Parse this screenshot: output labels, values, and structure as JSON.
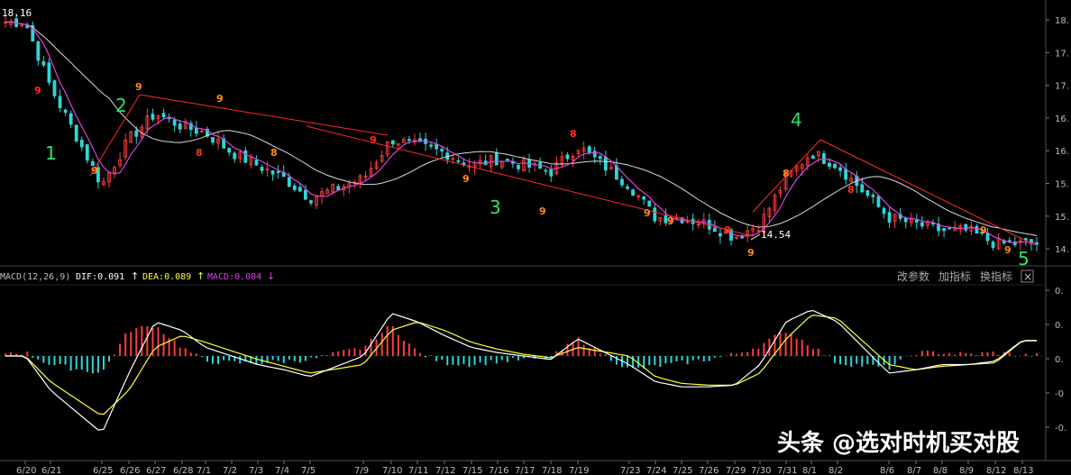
{
  "price_panel": {
    "top_left_label": "18.16",
    "low_label": "14.54",
    "wave_labels": [
      "1",
      "2",
      "3",
      "4",
      "5"
    ],
    "yticks": [
      "18.",
      "17.",
      "17.",
      "16.",
      "16.",
      "15.",
      "15.",
      "14."
    ],
    "td_labels": [
      "9",
      "9",
      "9",
      "8",
      "9",
      "8",
      "9",
      "9",
      "9",
      "8",
      "9",
      "9",
      "8",
      "9",
      "8",
      "8",
      "9",
      "9"
    ]
  },
  "macd_header": {
    "params": "MACD(12,26,9)",
    "dif_label": "DIF:0.091",
    "dif_arrow": "↑",
    "dea_label": "DEA:0.089",
    "dea_arrow": "↑",
    "macd_label": "MACD:0.004",
    "macd_arrow": "↓",
    "btn_params": "改参数",
    "btn_add": "加指标",
    "btn_switch": "换指标",
    "btn_close": "×"
  },
  "macd_panel": {
    "yticks": [
      "0.",
      "0.",
      "0.",
      "-0",
      "-0."
    ]
  },
  "x_axis": {
    "dates": [
      "6/20",
      "6/21",
      "6/25",
      "6/26",
      "6/27",
      "6/28",
      "7/1",
      "7/2",
      "7/3",
      "7/4",
      "7/5",
      "7/9",
      "7/10",
      "7/11",
      "7/12",
      "7/15",
      "7/16",
      "7/17",
      "7/18",
      "7/19",
      "7/23",
      "7/24",
      "7/25",
      "7/26",
      "7/29",
      "7/30",
      "7/31",
      "8/1",
      "8/2",
      "8/6",
      "8/7",
      "8/8",
      "8/9",
      "8/12",
      "8/13"
    ]
  },
  "watermark": {
    "text": "头条 @选对时机买对股"
  },
  "colors": {
    "up": "#ff3c3c",
    "down": "#2fd6d6",
    "ma_short": "#e040e0",
    "ma_long": "#d8d8d8",
    "dea": "#ffff33",
    "dif": "#ffffff",
    "wave": "#2ee36a",
    "td_orange": "#ff8c1a",
    "td_red": "#ff3020",
    "trend": "#ff2a2a"
  },
  "chart_data": [
    {
      "type": "candlestick",
      "title": "",
      "x": [
        "6/20",
        "6/21",
        "6/25",
        "6/26",
        "6/27",
        "6/28",
        "7/1",
        "7/2",
        "7/3",
        "7/4",
        "7/5",
        "7/9",
        "7/10",
        "7/11",
        "7/12",
        "7/15",
        "7/16",
        "7/17",
        "7/18",
        "7/19",
        "7/23",
        "7/24",
        "7/25",
        "7/26",
        "7/29",
        "7/30",
        "7/31",
        "8/1",
        "8/2",
        "8/6",
        "8/7",
        "8/8",
        "8/9",
        "8/12",
        "8/13"
      ],
      "close_approx": [
        18.0,
        17.0,
        15.5,
        16.2,
        16.6,
        16.4,
        16.3,
        16.0,
        15.8,
        15.6,
        15.3,
        15.6,
        16.2,
        16.1,
        16.0,
        15.8,
        15.9,
        15.8,
        15.7,
        16.1,
        15.5,
        15.0,
        15.0,
        14.9,
        14.7,
        14.9,
        15.6,
        16.0,
        15.8,
        15.0,
        14.9,
        14.8,
        14.8,
        14.6,
        14.6
      ],
      "ylim": [
        14.3,
        18.2
      ],
      "annotations": [
        "18.16",
        "14.54"
      ],
      "series": [
        {
          "name": "",
          "type": "ma_short"
        },
        {
          "name": "",
          "type": "ma_long"
        }
      ]
    },
    {
      "type": "bar",
      "title": "MACD(12,26,9)",
      "x": [
        "6/20",
        "6/21",
        "6/25",
        "6/26",
        "6/27",
        "6/28",
        "7/1",
        "7/2",
        "7/3",
        "7/4",
        "7/5",
        "7/9",
        "7/10",
        "7/11",
        "7/12",
        "7/15",
        "7/16",
        "7/17",
        "7/18",
        "7/19",
        "7/23",
        "7/24",
        "7/25",
        "7/26",
        "7/29",
        "7/30",
        "7/31",
        "8/1",
        "8/2",
        "8/6",
        "8/7",
        "8/8",
        "8/9",
        "8/12",
        "8/13"
      ],
      "series": [
        {
          "name": "DIF",
          "values": [
            0.0,
            -0.2,
            -0.45,
            -0.1,
            0.2,
            0.15,
            0.05,
            0.0,
            -0.05,
            -0.08,
            -0.12,
            0.0,
            0.25,
            0.2,
            0.12,
            0.05,
            0.02,
            0.0,
            -0.02,
            0.1,
            -0.05,
            -0.15,
            -0.18,
            -0.18,
            -0.17,
            -0.05,
            0.2,
            0.27,
            0.2,
            -0.1,
            -0.08,
            -0.05,
            -0.05,
            -0.03,
            0.091
          ]
        },
        {
          "name": "DEA",
          "values": [
            0.0,
            -0.15,
            -0.35,
            -0.2,
            0.05,
            0.12,
            0.08,
            0.03,
            -0.02,
            -0.06,
            -0.1,
            -0.05,
            0.15,
            0.2,
            0.15,
            0.08,
            0.04,
            0.01,
            -0.01,
            0.05,
            0.0,
            -0.12,
            -0.16,
            -0.17,
            -0.17,
            -0.1,
            0.1,
            0.24,
            0.22,
            -0.05,
            -0.08,
            -0.06,
            -0.05,
            -0.04,
            0.089
          ]
        },
        {
          "name": "MACD",
          "values": [
            0.02,
            -0.05,
            -0.1,
            0.15,
            0.18,
            0.05,
            -0.03,
            -0.04,
            -0.04,
            -0.03,
            -0.02,
            0.05,
            0.18,
            0.02,
            -0.04,
            -0.05,
            -0.03,
            -0.02,
            -0.01,
            0.1,
            -0.08,
            -0.06,
            -0.04,
            -0.02,
            0.01,
            0.06,
            0.15,
            0.06,
            -0.04,
            -0.07,
            0.02,
            0.02,
            0.01,
            0.02,
            0.004
          ]
        }
      ]
    }
  ]
}
